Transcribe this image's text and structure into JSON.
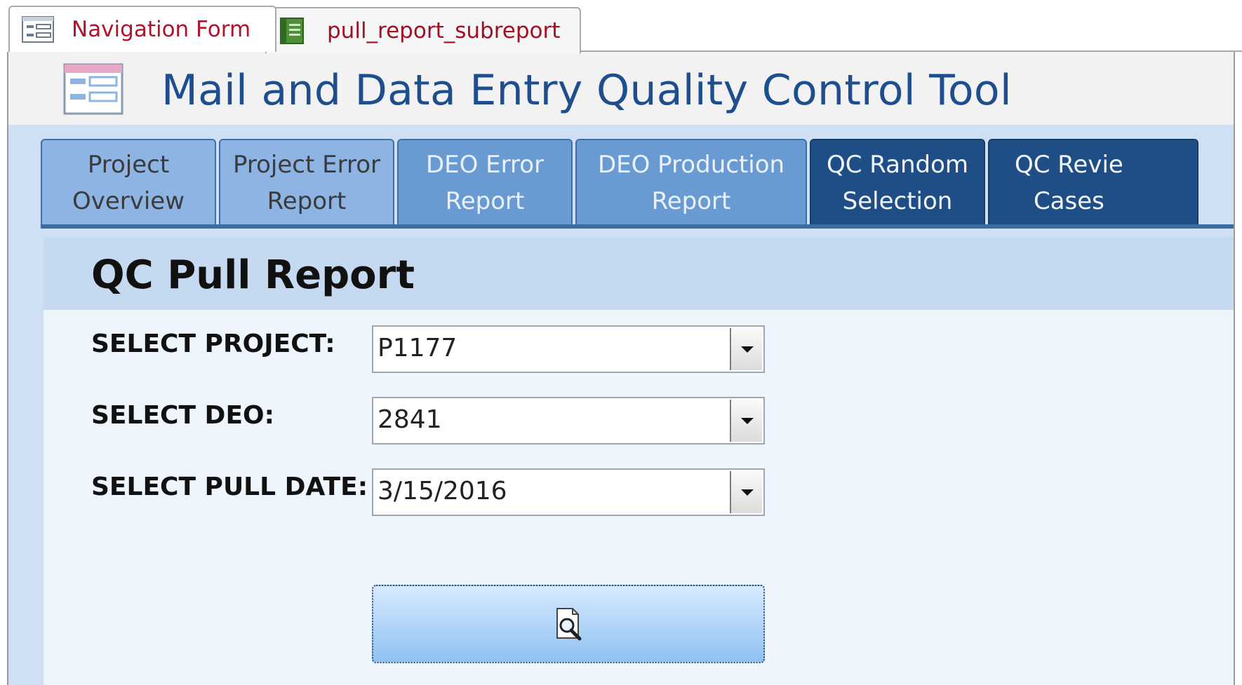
{
  "document_tabs": [
    {
      "label": "Navigation Form",
      "icon": "form-icon",
      "active": true
    },
    {
      "label": "pull_report_subreport",
      "icon": "report-icon",
      "active": false
    }
  ],
  "header": {
    "title": "Mail and Data Entry Quality Control Tool",
    "icon": "form-icon"
  },
  "nav_tabs": [
    {
      "label": "Project\nOverview"
    },
    {
      "label": "Project Error\nReport"
    },
    {
      "label": "DEO Error\nReport"
    },
    {
      "label": "DEO Production\nReport"
    },
    {
      "label": "QC Random\nSelection"
    },
    {
      "label": "QC Revie\nCases"
    }
  ],
  "report": {
    "title": "QC Pull Report",
    "fields": {
      "project": {
        "label": "SELECT PROJECT:",
        "value": "P1177"
      },
      "deo": {
        "label": "SELECT DEO:",
        "value": "2841"
      },
      "pull_date": {
        "label": "SELECT PULL DATE:",
        "value": "3/15/2016"
      }
    },
    "preview_button": {
      "icon": "print-preview-icon"
    }
  },
  "colors": {
    "title_blue": "#1f4e8f",
    "tab_red": "#b3122a",
    "nav_light": "#8db4e2",
    "nav_mid": "#6a9ad2",
    "nav_dark": "#1f4e86",
    "body_bg": "#cfe0f4",
    "content_bg": "#eef5fd"
  }
}
